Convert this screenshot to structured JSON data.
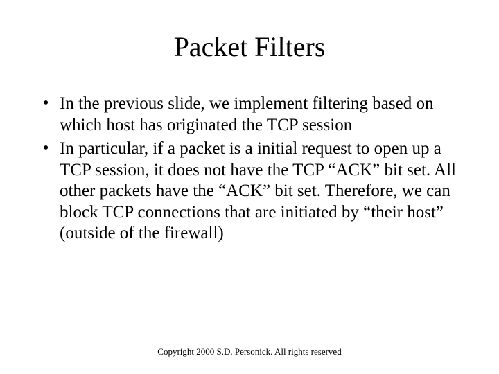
{
  "title": "Packet Filters",
  "bullets": [
    "In the previous slide, we implement filtering based on which host has originated the TCP session",
    "In particular, if a packet is a initial request to open up a TCP session, it does not have the TCP “ACK” bit set. All other packets have the “ACK” bit set. Therefore, we can block TCP connections that are initiated by “their host” (outside of the firewall)"
  ],
  "footer": "Copyright 2000 S.D. Personick. All rights reserved"
}
